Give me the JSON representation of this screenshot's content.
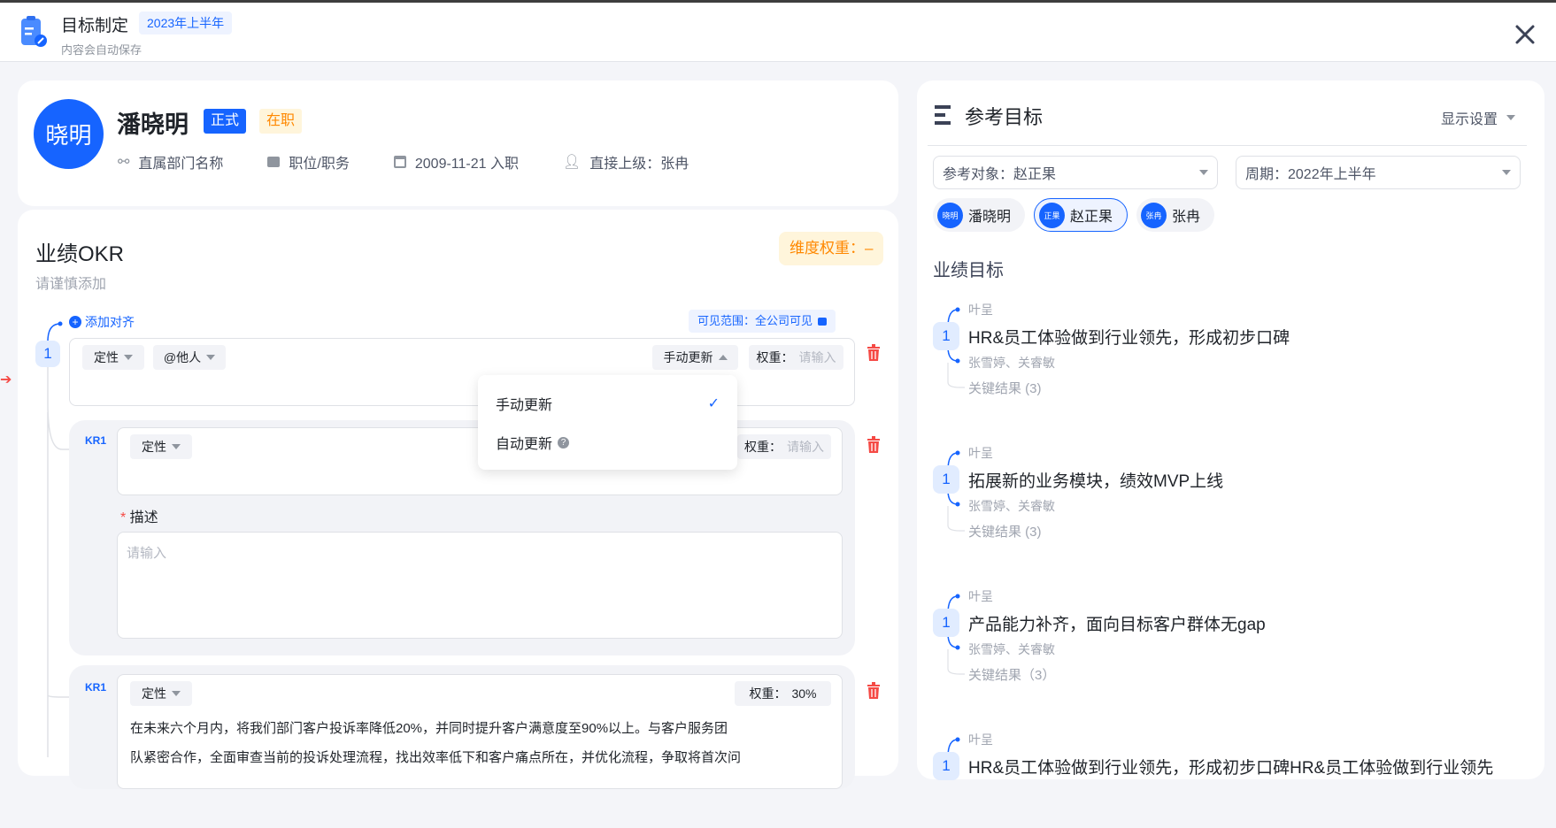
{
  "header": {
    "title": "目标制定",
    "period_badge": "2023年上半年",
    "subtitle": "内容会自动保存"
  },
  "profile": {
    "avatar_text": "晓明",
    "name": "潘晓明",
    "badge_type": "正式",
    "badge_status": "在职",
    "department": "直属部门名称",
    "position": "职位/职务",
    "join_date": "2009-11-21 入职",
    "manager": "直接上级：张冉"
  },
  "okr": {
    "title": "业绩OKR",
    "hint": "请谨慎添加",
    "dimension_weight": "维度权重：–",
    "add_align": "添加对齐",
    "visibility": "可见范围：全公司可见",
    "objective": {
      "index": "1",
      "type": "定性",
      "mention": "@他人",
      "update_mode": "手动更新",
      "weight_label": "权重：",
      "weight_placeholder": "请输入"
    },
    "dropdown": {
      "items": [
        {
          "label": "手动更新",
          "selected": true
        },
        {
          "label": "自动更新",
          "selected": false
        }
      ]
    },
    "krs": [
      {
        "label": "KR1",
        "type": "定性",
        "weight_label": "权重：",
        "weight_placeholder": "请输入",
        "desc_label": "描述",
        "desc_placeholder": "请输入"
      },
      {
        "label": "KR1",
        "type": "定性",
        "weight_label": "权重：",
        "weight_value": "30%",
        "text_line1": "在未来六个月内，将我们部门客户投诉率降低20%，并同时提升客户满意度至90%以上。与客户服务团",
        "text_line2": "队紧密合作，全面审查当前的投诉处理流程，找出效率低下和客户痛点所在，并优化流程，争取将首次问"
      }
    ]
  },
  "reference": {
    "title": "参考目标",
    "display_settings": "显示设置",
    "target_select": "参考对象：赵正果",
    "period_select": "周期：2022年上半年",
    "people": [
      {
        "avatar": "晓明",
        "name": "潘晓明"
      },
      {
        "avatar": "正果",
        "name": "赵正果"
      },
      {
        "avatar": "张冉",
        "name": "张冉"
      }
    ],
    "section": "业绩目标",
    "goals": [
      {
        "index": "1",
        "owner": "叶呈",
        "title": "HR&员工体验做到行业领先，形成初步口碑",
        "aligned": "张雪婷、关睿敏",
        "krs": "关键结果 (3)"
      },
      {
        "index": "1",
        "owner": "叶呈",
        "title": "拓展新的业务模块，绩效MVP上线",
        "aligned": "张雪婷、关睿敏",
        "krs": "关键结果 (3)"
      },
      {
        "index": "1",
        "owner": "叶呈",
        "title": "产品能力补齐，面向目标客户群体无gap",
        "aligned": "张雪婷、关睿敏",
        "krs": "关键结果（3）"
      },
      {
        "index": "1",
        "owner": "叶呈",
        "title": "HR&员工体验做到行业领先，形成初步口碑HR&员工体验做到行业领先"
      }
    ]
  },
  "colors": {
    "primary": "#1664ff",
    "warning": "#ff8800",
    "danger": "#f54a45"
  }
}
